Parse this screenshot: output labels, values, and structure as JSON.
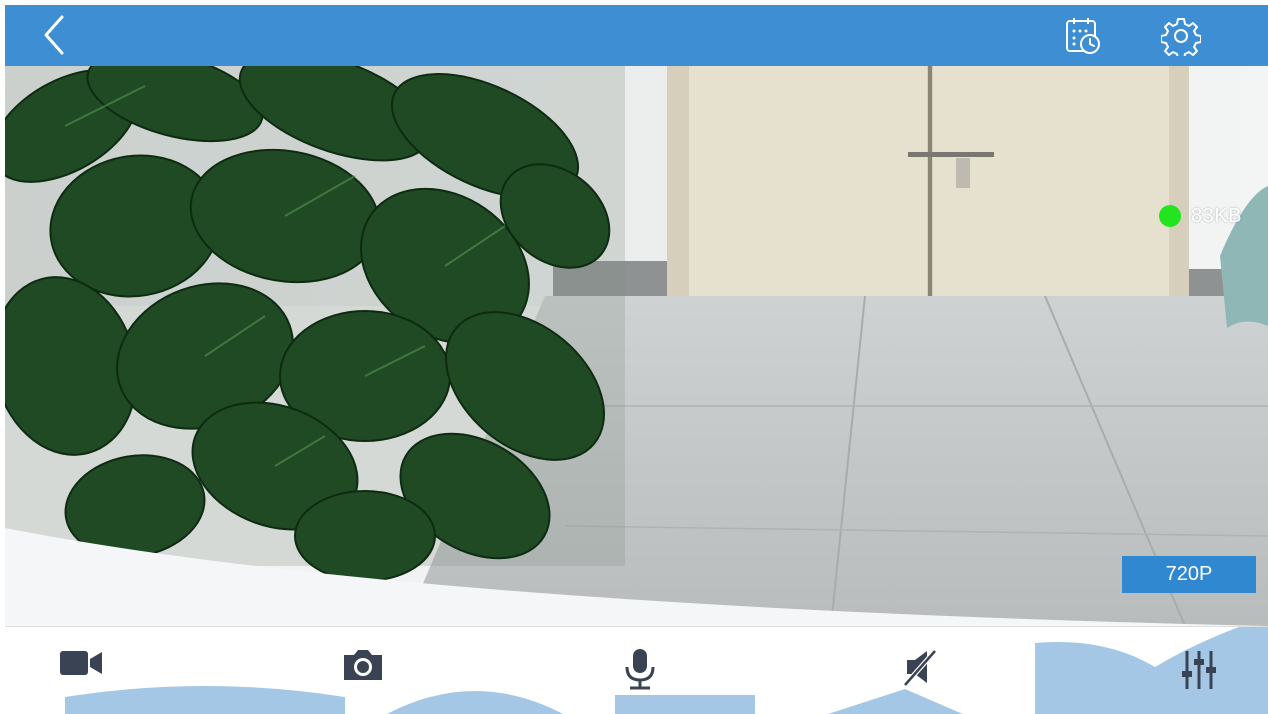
{
  "topbar": {
    "background": "#3d8ed2",
    "back_icon": "chevron-left-icon",
    "schedule_icon": "calendar-clock-icon",
    "settings_icon": "gear-icon"
  },
  "video": {
    "bitrate_text": "83KB",
    "status_color": "#22e51f",
    "resolution_label": "720P"
  },
  "toolbar": {
    "items": [
      {
        "name": "record",
        "icon": "video-camera-icon"
      },
      {
        "name": "snapshot",
        "icon": "camera-icon"
      },
      {
        "name": "talk",
        "icon": "microphone-icon"
      },
      {
        "name": "audio",
        "icon": "speaker-muted-icon"
      },
      {
        "name": "adjust",
        "icon": "sliders-icon"
      }
    ],
    "icon_color": "#3a4353"
  }
}
